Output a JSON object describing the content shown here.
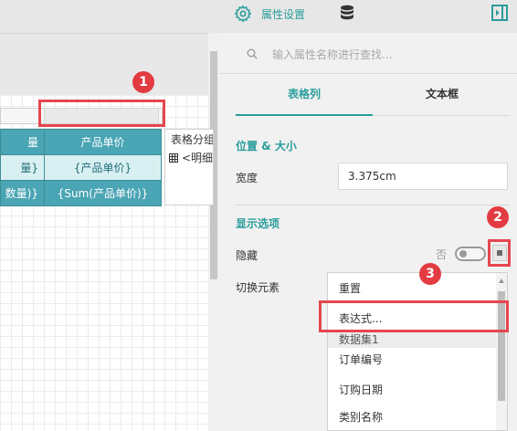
{
  "topbar": {
    "property_tab_label": "属性设置",
    "icons": [
      "gear-icon",
      "database-icon",
      "collapse-panel-icon"
    ]
  },
  "canvas": {
    "table": {
      "header": [
        "量",
        "产品单价"
      ],
      "detail": [
        "量}",
        "{产品单价}"
      ],
      "summary": [
        "数量)}",
        "{Sum(产品单价)}"
      ]
    },
    "popup": {
      "title": "表格分组",
      "item": "<明细",
      "item_icon": "table-grid-icon"
    }
  },
  "panel": {
    "search_placeholder": "输入属性名称进行查找...",
    "tabs": [
      {
        "label": "表格列",
        "active": true
      },
      {
        "label": "文本框",
        "active": false
      }
    ],
    "section_position": "位置 & 大小",
    "width_label": "宽度",
    "width_value": "3.375cm",
    "section_display": "显示选项",
    "hidden_label": "隐藏",
    "toggle_off_label": "否",
    "toggle_state": false,
    "toggle_element_label": "切换元素",
    "dropdown_items": [
      {
        "label": "重置",
        "type": "option"
      },
      {
        "label": "表达式...",
        "type": "option"
      },
      {
        "label": "数据集1",
        "type": "group"
      },
      {
        "label": "订单编号",
        "type": "option"
      },
      {
        "label": "订购日期",
        "type": "option"
      },
      {
        "label": "类别名称",
        "type": "option"
      }
    ]
  },
  "annotations": [
    {
      "number": "1"
    },
    {
      "number": "2"
    },
    {
      "number": "3"
    }
  ],
  "colors": {
    "accent": "#2a9d9b",
    "table_header": "#4aa5b4",
    "table_detail": "#d9f0f2",
    "callout": "#e5464f"
  }
}
